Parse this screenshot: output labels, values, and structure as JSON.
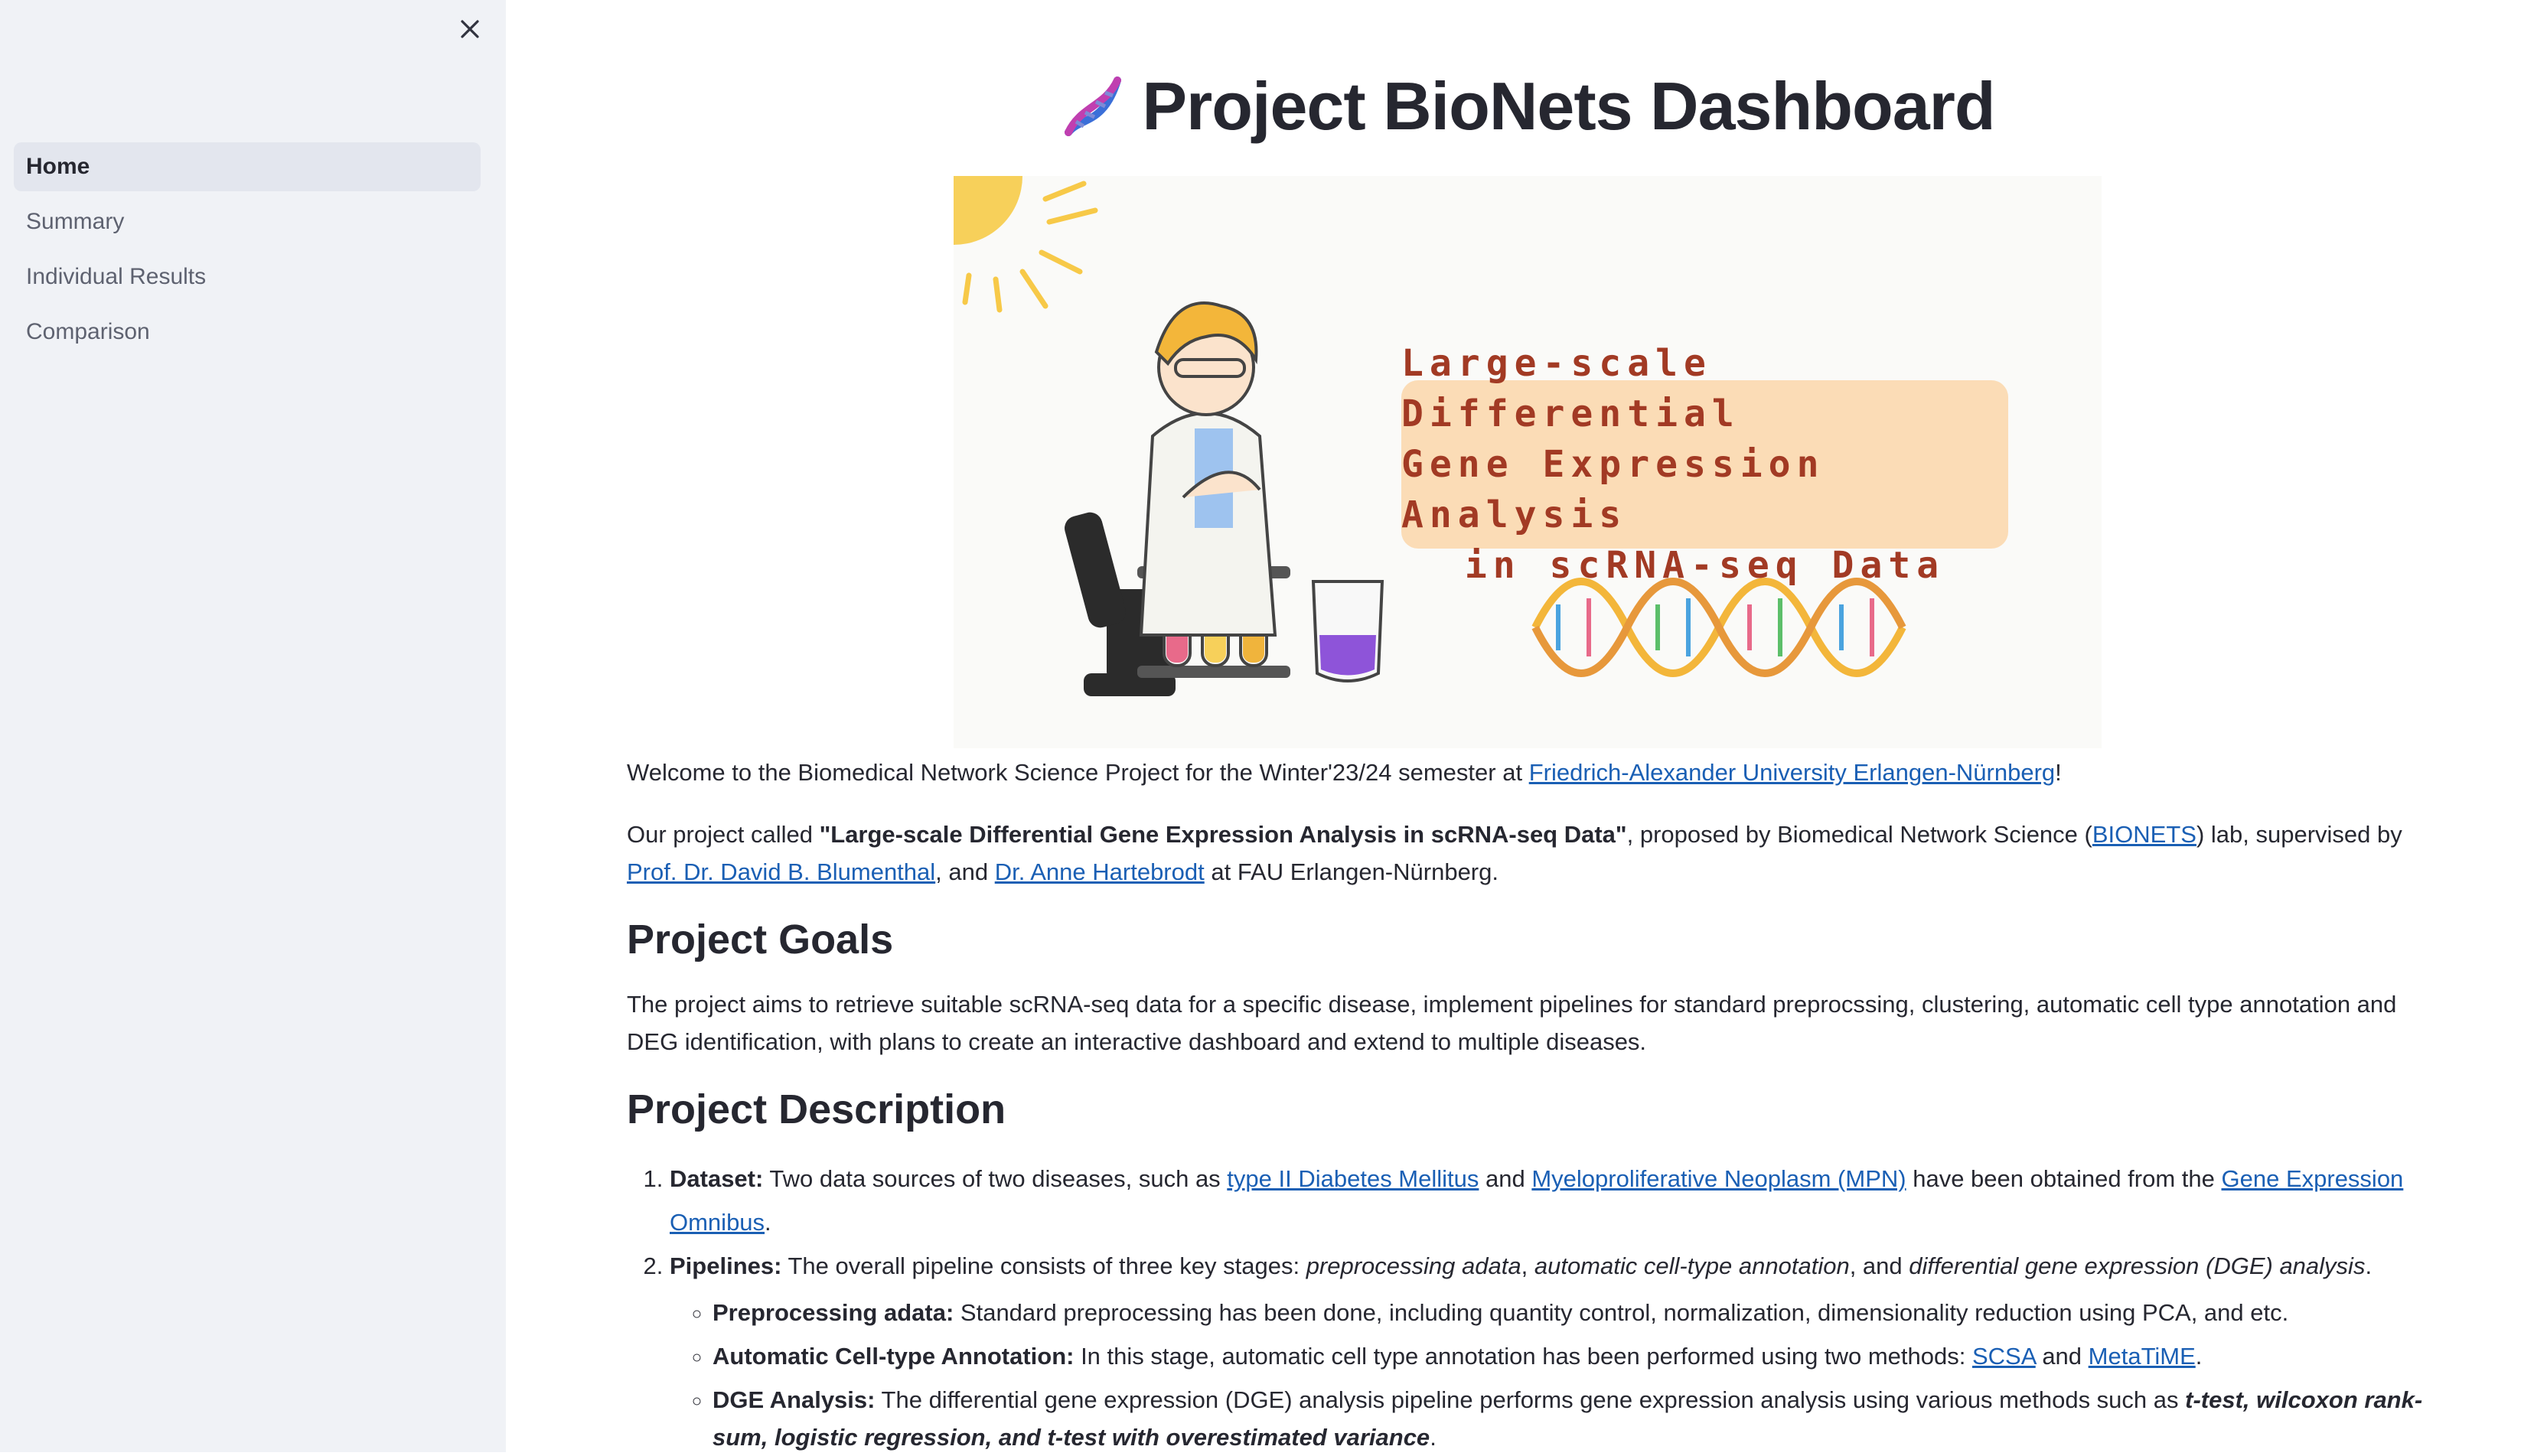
{
  "sidebar": {
    "nav_items": [
      {
        "label": "Home",
        "active": true
      },
      {
        "label": "Summary",
        "active": false
      },
      {
        "label": "Individual Results",
        "active": false
      },
      {
        "label": "Comparison",
        "active": false
      }
    ]
  },
  "header": {
    "icon": "dna-icon",
    "title": "Project BioNets Dashboard"
  },
  "banner": {
    "lines": [
      "Large-scale Differential",
      "Gene Expression Analysis",
      "in scRNA-seq Data"
    ]
  },
  "intro": {
    "welcome_prefix": "Welcome to the Biomedical Network Science Project for the Winter'23/24 semester at ",
    "university_link": "Friedrich-Alexander University Erlangen-Nürnberg",
    "welcome_suffix": "!",
    "p2_prefix": "Our project called ",
    "p2_title": "\"Large-scale Differential Gene Expression Analysis in scRNA-seq Data\"",
    "p2_mid1": ", proposed by Biomedical Network Science (",
    "bionets_link": "BIONETS",
    "p2_mid2": ") lab, supervised by ",
    "supervisor1_link": "Prof. Dr. David B. Blumenthal",
    "p2_mid3": ", and ",
    "supervisor2_link": "Dr. Anne Hartebrodt",
    "p2_suffix": " at FAU Erlangen-Nürnberg."
  },
  "goals": {
    "heading": "Project Goals",
    "text": "The project aims to retrieve suitable scRNA-seq data for a specific disease, implement pipelines for standard preprocssing, clustering, automatic cell type annotation and DEG identification, with plans to create an interactive dashboard and extend to multiple diseases."
  },
  "description": {
    "heading": "Project Description",
    "dataset_label": "Dataset:",
    "dataset_text1": " Two data sources of two diseases, such as ",
    "diabetes_link": "type II Diabetes Mellitus",
    "dataset_and": " and ",
    "mpn_link": "Myeloproliferative Neoplasm (MPN)",
    "dataset_text2": " have been obtained from the ",
    "geo_link": "Gene Expression Omnibus",
    "dataset_end": ".",
    "pipelines_label": "Pipelines:",
    "pipelines_text": " The overall pipeline consists of three key stages: ",
    "stage1": "preprocessing adata",
    "comma": ", ",
    "stage2": "automatic cell-type annotation",
    "and": ", and ",
    "stage3": "differential gene expression (DGE) analysis",
    "period": ".",
    "sub_items": {
      "preprocess_label": "Preprocessing adata:",
      "preprocess_text": " Standard preprocessing has been done, including quantity control, normalization, dimensionality reduction using PCA, and etc.",
      "annotation_label": "Automatic Cell-type Annotation:",
      "annotation_text": " In this stage, automatic cell type annotation has been performed using two methods: ",
      "scsa_link": "SCSA",
      "annotation_and": " and ",
      "metatime_link": "MetaTiME",
      "annotation_end": ".",
      "dge_label": "DGE Analysis:",
      "dge_text": " The differential gene expression (DGE) analysis pipeline performs gene expression analysis using various methods such as ",
      "dge_methods": "t-test, wilcoxon rank-sum, logistic regression, and t-test with overestimated variance",
      "dge_end": "."
    }
  },
  "colors": {
    "sidebar_bg": "#f0f2f6",
    "active_nav_bg": "#e3e6ee",
    "link": "#1a5fb4",
    "banner_card": "#fbdcb6",
    "banner_text": "#a23a24"
  }
}
